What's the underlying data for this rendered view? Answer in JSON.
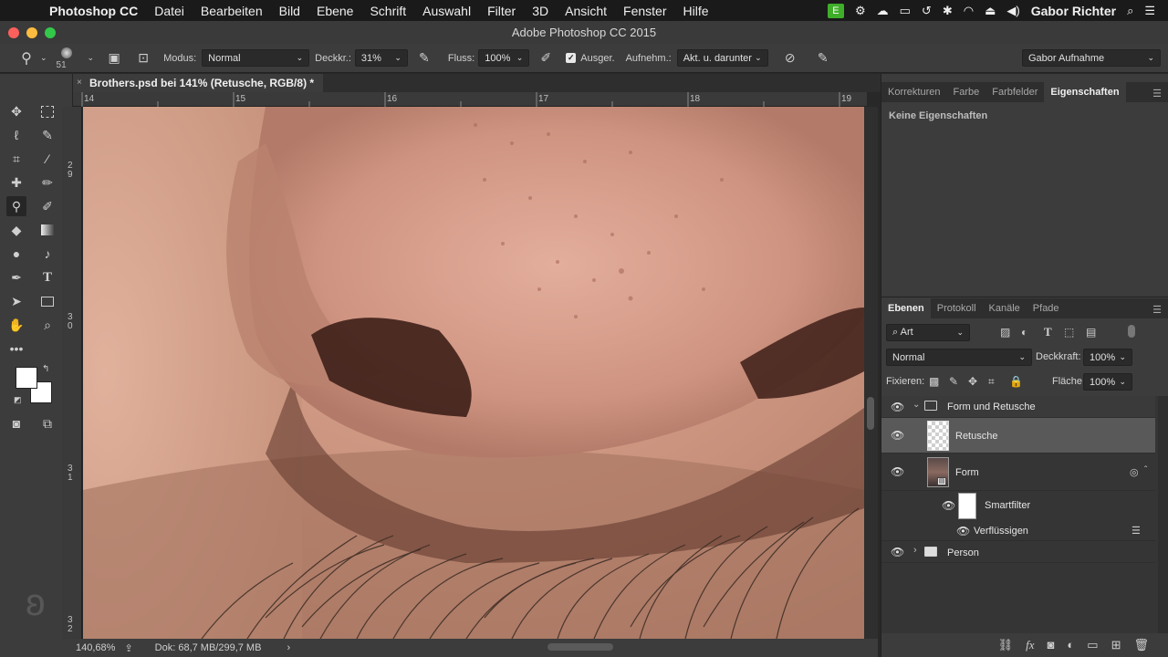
{
  "menubar": {
    "app_name": "Photoshop CC",
    "items": [
      "Datei",
      "Bearbeiten",
      "Bild",
      "Ebene",
      "Schrift",
      "Auswahl",
      "Filter",
      "3D",
      "Ansicht",
      "Fenster",
      "Hilfe"
    ],
    "user": "Gabor Richter"
  },
  "window": {
    "title": "Adobe Photoshop CC 2015"
  },
  "options": {
    "brush_size": "51",
    "mode_label": "Modus:",
    "mode_value": "Normal",
    "opacity_label": "Deckkr.:",
    "opacity_value": "31%",
    "flow_label": "Fluss:",
    "flow_value": "100%",
    "aligned_label": "Ausger.",
    "sample_label": "Aufnehm.:",
    "sample_value": "Akt. u. darunter",
    "workspace": "Gabor Aufnahme"
  },
  "document": {
    "tab_title": "Brothers.psd bei 141% (Retusche, RGB/8) *",
    "ruler_top": [
      "14",
      "15",
      "16",
      "17",
      "18",
      "19"
    ],
    "ruler_left": [
      "2\n9",
      "3\n0",
      "3\n1",
      "3\n2"
    ]
  },
  "status": {
    "zoom": "140,68%",
    "doc_info": "Dok: 68,7 MB/299,7 MB"
  },
  "properties_panel": {
    "tabs": [
      "Korrekturen",
      "Farbe",
      "Farbfelder",
      "Eigenschaften"
    ],
    "active_tab": "Eigenschaften",
    "content": "Keine Eigenschaften"
  },
  "layers_panel": {
    "tabs": [
      "Ebenen",
      "Protokoll",
      "Kanäle",
      "Pfade"
    ],
    "active_tab": "Ebenen",
    "filter_kind": "Art",
    "blend_mode": "Normal",
    "opacity_label": "Deckkraft:",
    "opacity_value": "100%",
    "lock_label": "Fixieren:",
    "fill_label": "Fläche:",
    "fill_value": "100%",
    "layers": [
      {
        "name": "Form und Retusche",
        "type": "group",
        "expanded": true
      },
      {
        "name": "Retusche",
        "type": "pixel",
        "selected": true
      },
      {
        "name": "Form",
        "type": "smart-object"
      },
      {
        "name": "Smartfilter",
        "type": "smart-filter"
      },
      {
        "name": "Verflüssigen",
        "type": "filter"
      },
      {
        "name": "Person",
        "type": "group",
        "expanded": false
      }
    ]
  },
  "colors": {
    "accent": "#31a8ff",
    "panel_bg": "#3c3c3c",
    "selected_layer": "#4a4a4a"
  }
}
